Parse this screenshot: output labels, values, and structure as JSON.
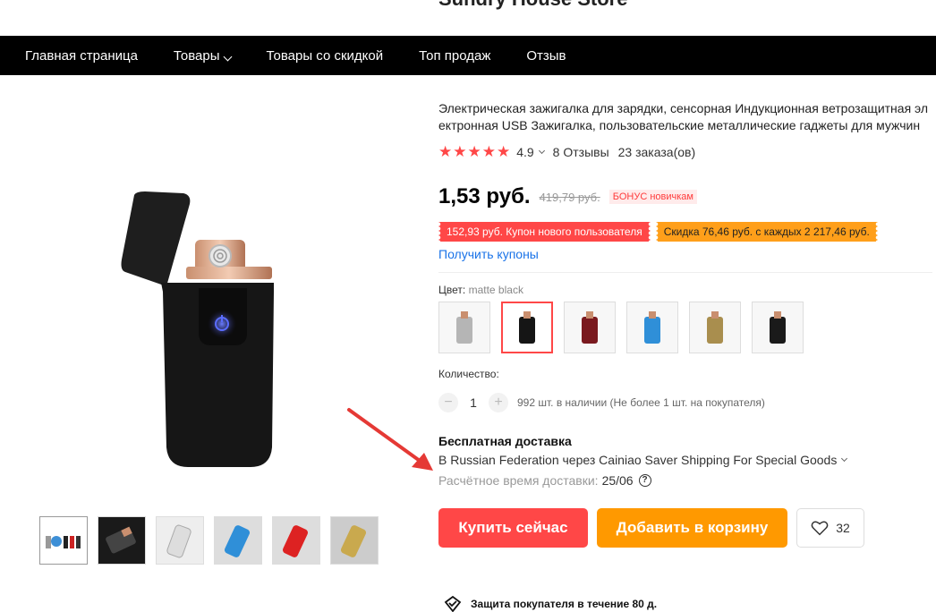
{
  "store": {
    "name": "Sundry House Store"
  },
  "nav": [
    {
      "label": "Главная страница",
      "dropdown": false
    },
    {
      "label": "Товары",
      "dropdown": true
    },
    {
      "label": "Товары со скидкой",
      "dropdown": false
    },
    {
      "label": "Топ продаж",
      "dropdown": false
    },
    {
      "label": "Отзыв",
      "dropdown": false
    }
  ],
  "product": {
    "title": "Электрическая зажигалка для зарядки, сенсорная Индукционная ветрозащитная электронная USB Зажигалка, пользовательские металлические гаджеты для мужчин",
    "stars": "★★★★★",
    "rating": "4.9",
    "reviews": "8 Отзывы",
    "orders": "23 заказа(ов)",
    "price": "1,53 руб.",
    "old_price": "419,79 руб.",
    "bonus": "БОНУС новичкам",
    "coupon_new_user": "152,93 руб. Купон нового пользователя",
    "coupon_discount": "Скидка 76,46 руб. с каждых 2 217,46 руб.",
    "get_coupons": "Получить купоны",
    "color_label": "Цвет:",
    "color_value": "matte black",
    "colors": [
      "silver",
      "matte black",
      "dark red",
      "blue",
      "gold",
      "black"
    ],
    "colors_hex": [
      "#b5b5b5",
      "#151515",
      "#7a1a1f",
      "#2f8fd8",
      "#a98e4e",
      "#1a1a1a"
    ],
    "qty_label": "Количество:",
    "qty_minus": "−",
    "qty_plus": "+",
    "qty_value": "1",
    "stock": "992 шт. в наличии (Не более 1 шт. на покупателя)"
  },
  "shipping": {
    "title": "Бесплатная доставка",
    "line": "В Russian Federation через Cainiao Saver Shipping For Special Goods",
    "eta_label": "Расчётное время доставки:",
    "eta_date": "25/06",
    "help": "?"
  },
  "actions": {
    "buy": "Купить сейчас",
    "cart": "Добавить в корзину",
    "wishlist_count": "32"
  },
  "protection": "Защита покупателя в течение 80 д.",
  "colors": {
    "accent_red": "#ff4747",
    "accent_orange": "#ff9900",
    "nav_bg": "#000000",
    "link": "#1a73e8"
  }
}
